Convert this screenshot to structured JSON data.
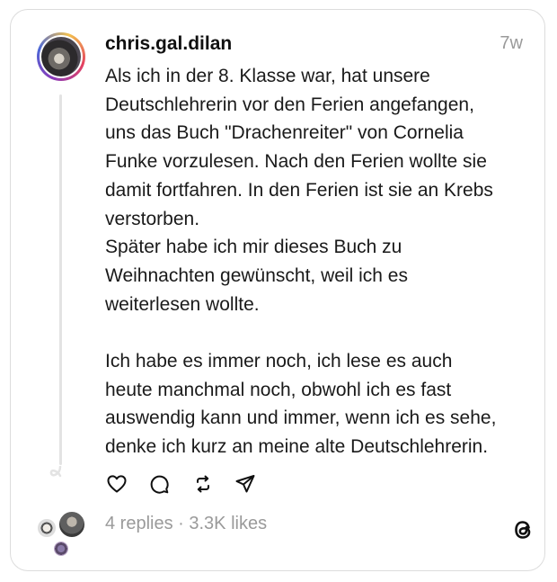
{
  "post": {
    "username": "chris.gal.dilan",
    "timestamp": "7w",
    "text": "Als ich in der 8. Klasse war, hat unsere\nDeutschlehrerin vor den Ferien angefangen,\nuns das Buch \"Drachenreiter\" von Cornelia\nFunke vorzulesen. Nach den Ferien wollte sie\ndamit fortfahren. In den Ferien ist sie an Krebs\nverstorben.\nSpäter habe ich mir dieses Buch zu\nWeihnachten gewünscht, weil ich es\nweiterlesen wollte.\n\nIch habe es immer noch, ich lese es auch\nheute manchmal noch, obwohl ich es fast\nauswendig kann und immer, wenn ich es sehe,\ndenke ich kurz an meine alte Deutschlehrerin."
  },
  "actions": {
    "like_icon": "heart-icon",
    "reply_icon": "comment-icon",
    "repost_icon": "repost-icon",
    "share_icon": "send-icon"
  },
  "stats": {
    "summary": "4 replies · 3.3K likes"
  },
  "branding": {
    "logo": "threads-logo-icon"
  },
  "colors": {
    "text": "#101010",
    "muted": "#9a9a9a",
    "border": "#dcdcdc"
  }
}
